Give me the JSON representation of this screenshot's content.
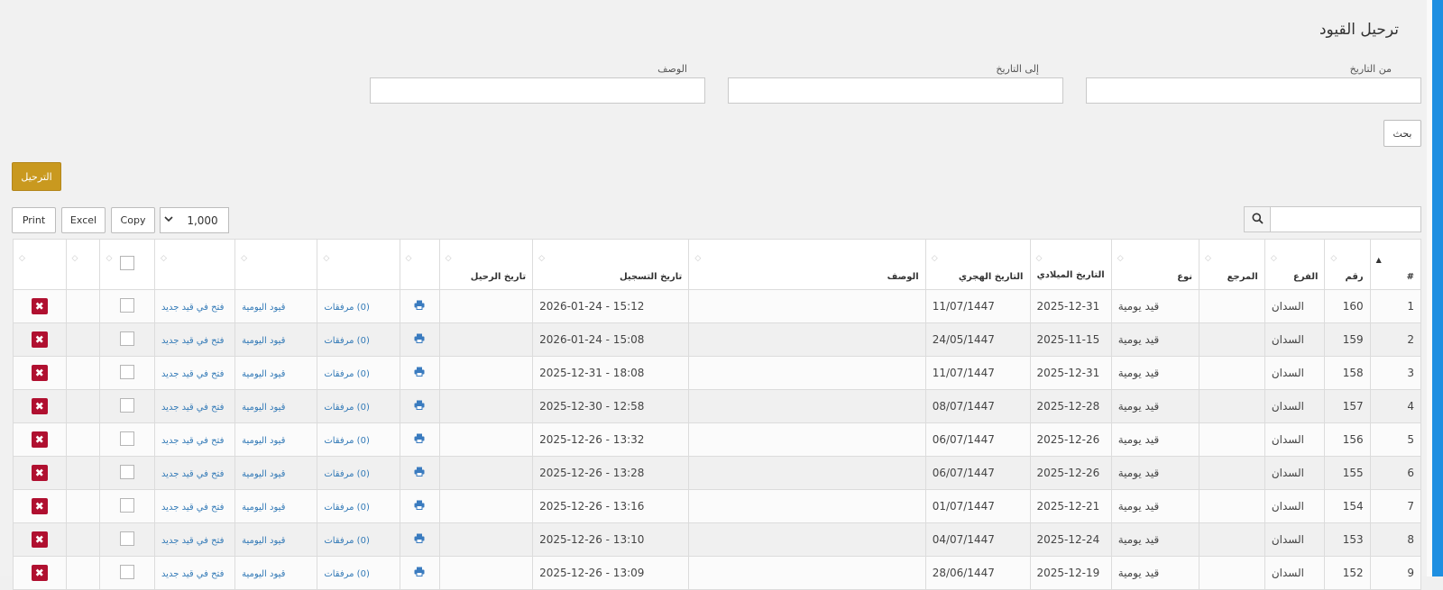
{
  "page": {
    "title": "ترحيل القيود"
  },
  "filters": {
    "from_date_label": "من التاريخ",
    "to_date_label": "إلى التاريخ",
    "description_label": "الوصف",
    "from_date_value": "",
    "to_date_value": "",
    "description_value": "",
    "search_button": "بحث"
  },
  "actions": {
    "post_button": "الترحيل"
  },
  "toolbar": {
    "print_label": "Print",
    "excel_label": "Excel",
    "copy_label": "Copy",
    "page_length": "1,000",
    "search_value": "",
    "search_icon": "search-icon"
  },
  "table": {
    "headers": {
      "index": "#",
      "number": "رقم",
      "branch": "الفرع",
      "reference": "المرجع",
      "type": "نوع",
      "gregorian_date": "التاريخ الميلادي",
      "hijri_date": "التاريخ الهجري",
      "description": "الوصف",
      "registration_date": "تاريخ التسجيل",
      "posting_date": "تاريخ الرحيل"
    },
    "rows": [
      {
        "idx": "1",
        "num": "160",
        "branch": "السدان",
        "ref": "",
        "type": "قيد يومية",
        "greg": "2025-12-31",
        "hijri": "11/07/1447",
        "desc": "",
        "reg": "2026-01-24 - 15:12",
        "post": "",
        "attach": "(0) مرفقات",
        "journal": "قيود اليومية",
        "open": "فتح في قيد جديد"
      },
      {
        "idx": "2",
        "num": "159",
        "branch": "السدان",
        "ref": "",
        "type": "قيد يومية",
        "greg": "2025-11-15",
        "hijri": "24/05/1447",
        "desc": "",
        "reg": "2026-01-24 - 15:08",
        "post": "",
        "attach": "(0) مرفقات",
        "journal": "قيود اليومية",
        "open": "فتح في قيد جديد"
      },
      {
        "idx": "3",
        "num": "158",
        "branch": "السدان",
        "ref": "",
        "type": "قيد يومية",
        "greg": "2025-12-31",
        "hijri": "11/07/1447",
        "desc": "",
        "reg": "2025-12-31 - 18:08",
        "post": "",
        "attach": "(0) مرفقات",
        "journal": "قيود اليومية",
        "open": "فتح في قيد جديد"
      },
      {
        "idx": "4",
        "num": "157",
        "branch": "السدان",
        "ref": "",
        "type": "قيد يومية",
        "greg": "2025-12-28",
        "hijri": "08/07/1447",
        "desc": "",
        "reg": "2025-12-30 - 12:58",
        "post": "",
        "attach": "(0) مرفقات",
        "journal": "قيود اليومية",
        "open": "فتح في قيد جديد"
      },
      {
        "idx": "5",
        "num": "156",
        "branch": "السدان",
        "ref": "",
        "type": "قيد يومية",
        "greg": "2025-12-26",
        "hijri": "06/07/1447",
        "desc": "",
        "reg": "2025-12-26 - 13:32",
        "post": "",
        "attach": "(0) مرفقات",
        "journal": "قيود اليومية",
        "open": "فتح في قيد جديد"
      },
      {
        "idx": "6",
        "num": "155",
        "branch": "السدان",
        "ref": "",
        "type": "قيد يومية",
        "greg": "2025-12-26",
        "hijri": "06/07/1447",
        "desc": "",
        "reg": "2025-12-26 - 13:28",
        "post": "",
        "attach": "(0) مرفقات",
        "journal": "قيود اليومية",
        "open": "فتح في قيد جديد"
      },
      {
        "idx": "7",
        "num": "154",
        "branch": "السدان",
        "ref": "",
        "type": "قيد يومية",
        "greg": "2025-12-21",
        "hijri": "01/07/1447",
        "desc": "",
        "reg": "2025-12-26 - 13:16",
        "post": "",
        "attach": "(0) مرفقات",
        "journal": "قيود اليومية",
        "open": "فتح في قيد جديد"
      },
      {
        "idx": "8",
        "num": "153",
        "branch": "السدان",
        "ref": "",
        "type": "قيد يومية",
        "greg": "2025-12-24",
        "hijri": "04/07/1447",
        "desc": "",
        "reg": "2025-12-26 - 13:10",
        "post": "",
        "attach": "(0) مرفقات",
        "journal": "قيود اليومية",
        "open": "فتح في قيد جديد"
      },
      {
        "idx": "9",
        "num": "152",
        "branch": "السدان",
        "ref": "",
        "type": "قيد يومية",
        "greg": "2025-12-19",
        "hijri": "28/06/1447",
        "desc": "",
        "reg": "2025-12-26 - 13:09",
        "post": "",
        "attach": "(0) مرفقات",
        "journal": "قيود اليومية",
        "open": "فتح في قيد جديد"
      }
    ]
  },
  "icons": {
    "print_row": "printer-icon",
    "delete_row": "delete-icon",
    "sort": "sort-icon"
  },
  "colors": {
    "accent_gold": "#c9991f",
    "delete_red": "#b01030",
    "link_blue": "#337ab7",
    "side_blue": "#1e8fe1"
  }
}
